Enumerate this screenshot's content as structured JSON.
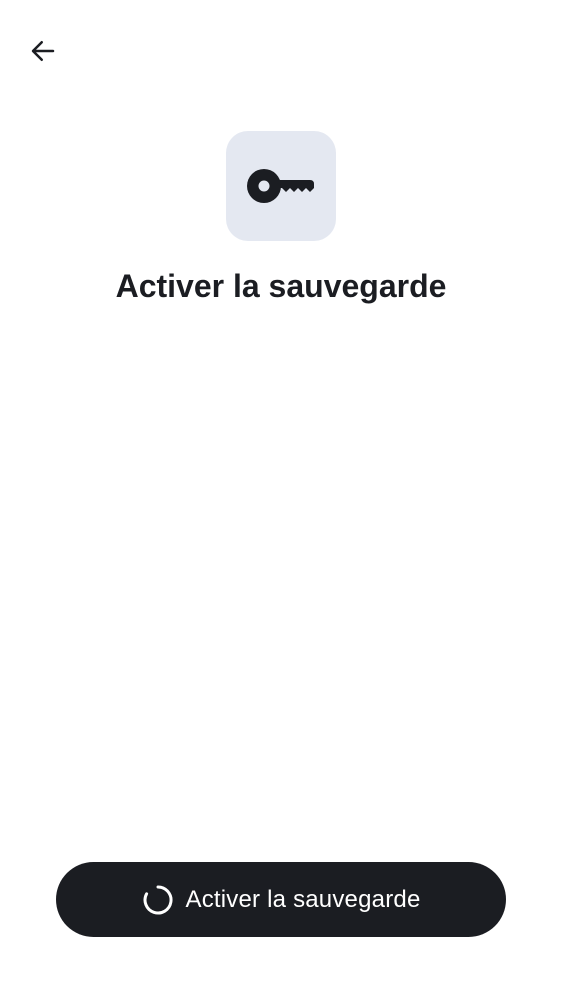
{
  "header": {
    "back_icon": "arrow-left-icon"
  },
  "hero": {
    "icon": "key-icon",
    "tile_color": "#E4E8F1",
    "title": "Activer la sauvegarde"
  },
  "footer": {
    "primary_button": {
      "label": "Activer la sauvegarde",
      "state": "loading",
      "spinner_icon": "loading-spinner-icon",
      "background": "#1B1D22",
      "text_color": "#FFFFFF"
    }
  }
}
